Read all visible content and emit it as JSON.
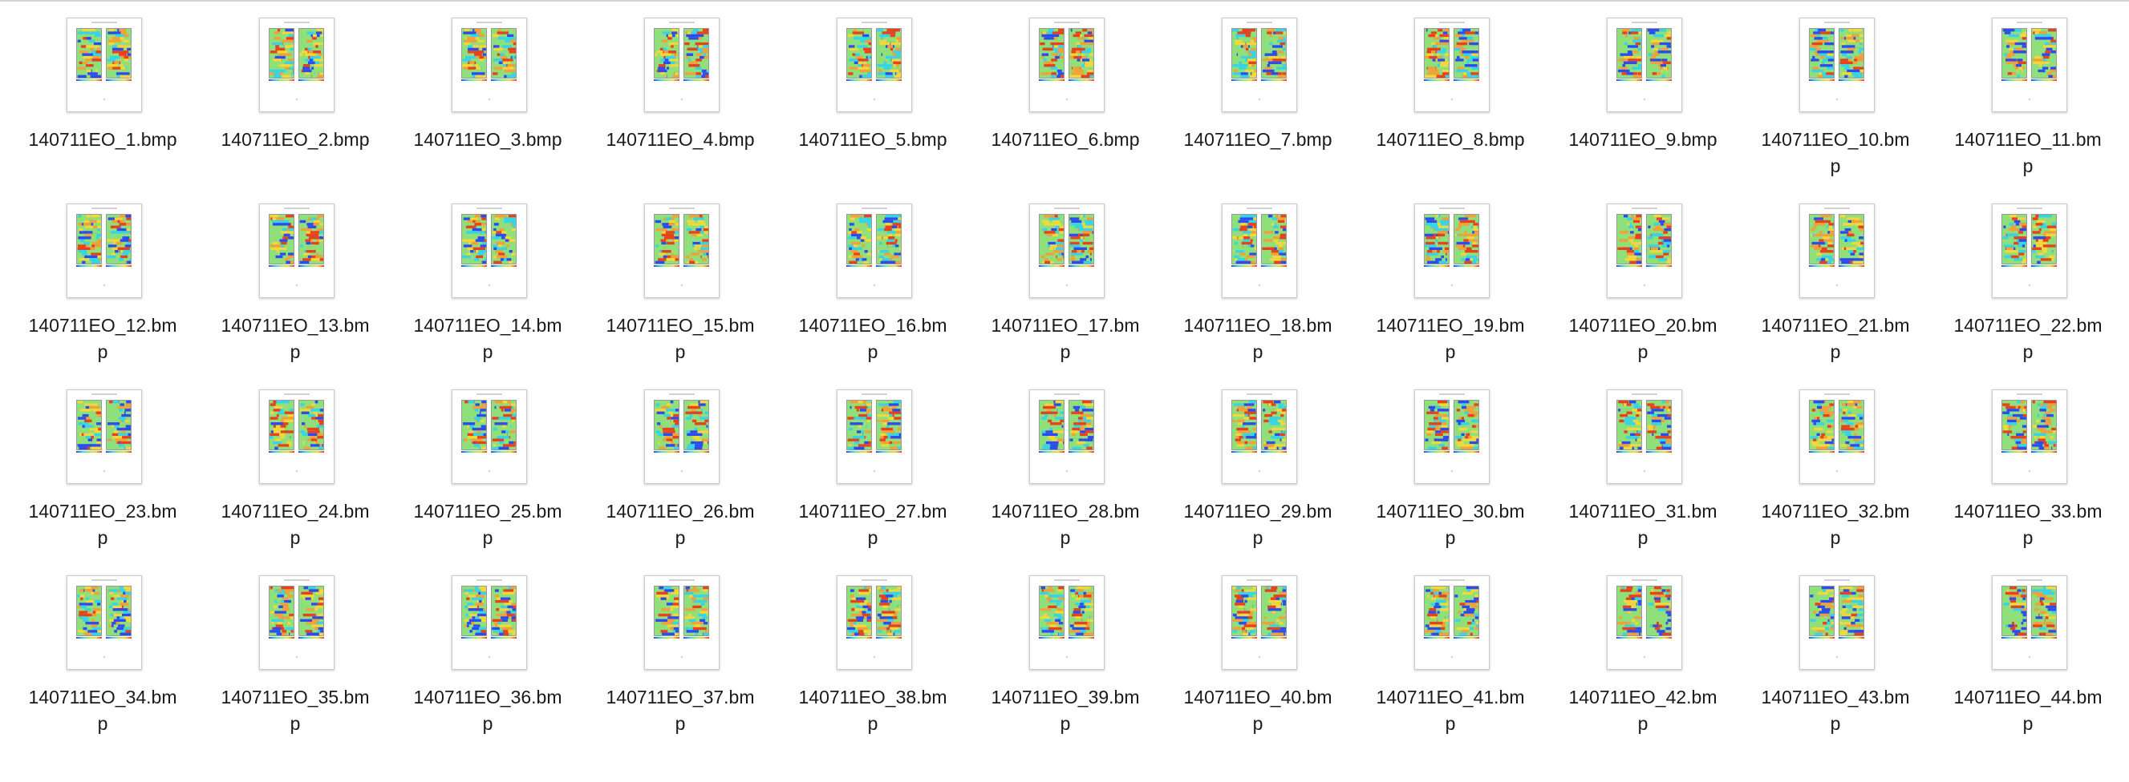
{
  "window": {
    "view_mode": "icon-view"
  },
  "icon": {
    "name": "bmp-file-thumbnail-icon",
    "colors": {
      "page": "#ffffff",
      "red": "#e8421d",
      "orange": "#f2a03a",
      "yellow": "#f2d83a",
      "green": "#8fe07a",
      "cyan": "#36d4e6",
      "blue": "#2b4cf0"
    }
  },
  "files": [
    {
      "name": "140711EO_1.bmp"
    },
    {
      "name": "140711EO_2.bmp"
    },
    {
      "name": "140711EO_3.bmp"
    },
    {
      "name": "140711EO_4.bmp"
    },
    {
      "name": "140711EO_5.bmp"
    },
    {
      "name": "140711EO_6.bmp"
    },
    {
      "name": "140711EO_7.bmp"
    },
    {
      "name": "140711EO_8.bmp"
    },
    {
      "name": "140711EO_9.bmp"
    },
    {
      "name": "140711EO_10.bmp"
    },
    {
      "name": "140711EO_11.bmp"
    },
    {
      "name": "140711EO_12.bmp"
    },
    {
      "name": "140711EO_13.bmp"
    },
    {
      "name": "140711EO_14.bmp"
    },
    {
      "name": "140711EO_15.bmp"
    },
    {
      "name": "140711EO_16.bmp"
    },
    {
      "name": "140711EO_17.bmp"
    },
    {
      "name": "140711EO_18.bmp"
    },
    {
      "name": "140711EO_19.bmp"
    },
    {
      "name": "140711EO_20.bmp"
    },
    {
      "name": "140711EO_21.bmp"
    },
    {
      "name": "140711EO_22.bmp"
    },
    {
      "name": "140711EO_23.bmp"
    },
    {
      "name": "140711EO_24.bmp"
    },
    {
      "name": "140711EO_25.bmp"
    },
    {
      "name": "140711EO_26.bmp"
    },
    {
      "name": "140711EO_27.bmp"
    },
    {
      "name": "140711EO_28.bmp"
    },
    {
      "name": "140711EO_29.bmp"
    },
    {
      "name": "140711EO_30.bmp"
    },
    {
      "name": "140711EO_31.bmp"
    },
    {
      "name": "140711EO_32.bmp"
    },
    {
      "name": "140711EO_33.bmp"
    },
    {
      "name": "140711EO_34.bmp"
    },
    {
      "name": "140711EO_35.bmp"
    },
    {
      "name": "140711EO_36.bmp"
    },
    {
      "name": "140711EO_37.bmp"
    },
    {
      "name": "140711EO_38.bmp"
    },
    {
      "name": "140711EO_39.bmp"
    },
    {
      "name": "140711EO_40.bmp"
    },
    {
      "name": "140711EO_41.bmp"
    },
    {
      "name": "140711EO_42.bmp"
    },
    {
      "name": "140711EO_43.bmp"
    },
    {
      "name": "140711EO_44.bmp"
    }
  ]
}
